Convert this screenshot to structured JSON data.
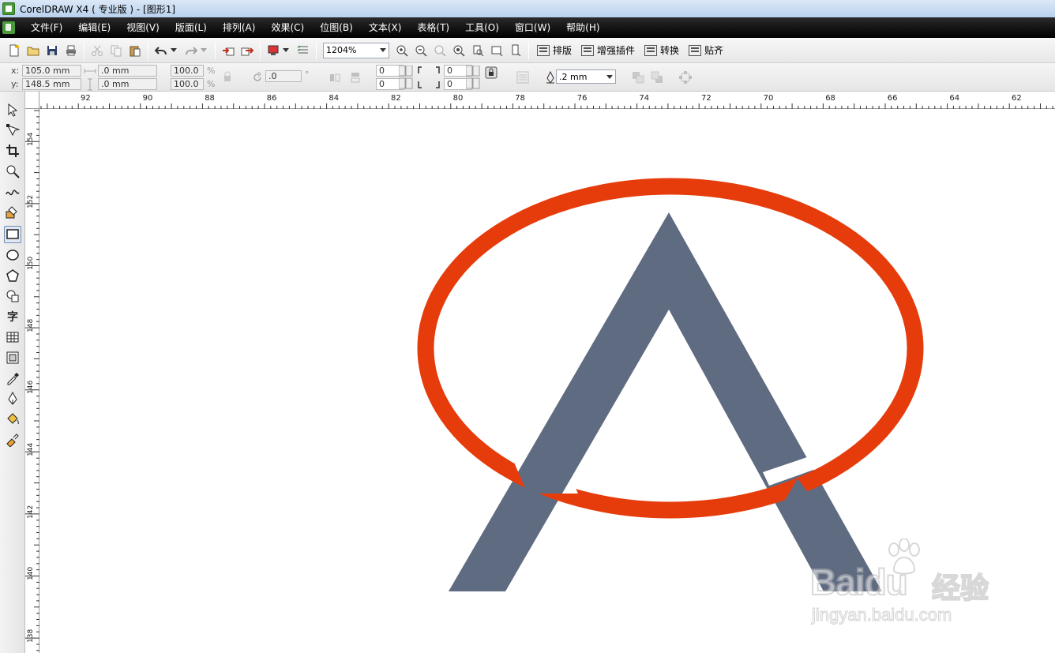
{
  "window": {
    "title": "CorelDRAW X4 ( 专业版 ) - [图形1]"
  },
  "menu": {
    "items": [
      "文件(F)",
      "编辑(E)",
      "视图(V)",
      "版面(L)",
      "排列(A)",
      "效果(C)",
      "位图(B)",
      "文本(X)",
      "表格(T)",
      "工具(O)",
      "窗口(W)",
      "帮助(H)"
    ]
  },
  "toolbar": {
    "zoom_value": "1204%",
    "plugins": [
      "排版",
      "增强插件",
      "转换",
      "贴齐"
    ]
  },
  "properties": {
    "x_label": "x:",
    "x_value": "105.0 mm",
    "y_label": "y:",
    "y_value": "148.5 mm",
    "width_value": ".0 mm",
    "height_value": ".0 mm",
    "scale_w": "100.0",
    "scale_h": "100.0",
    "percent": "%",
    "rotation": ".0",
    "degree": "°",
    "corner_a": "0",
    "corner_b": "0",
    "corner_c": "0",
    "corner_d": "0",
    "outline_width": ".2 mm"
  },
  "ruler": {
    "horizontal_labels": [
      "92",
      "90",
      "88",
      "86",
      "84",
      "82",
      "80",
      "78",
      "76",
      "74",
      "72",
      "70",
      "68",
      "66",
      "64",
      "62"
    ],
    "vertical_labels": [
      "154",
      "152",
      "150",
      "148",
      "146",
      "144",
      "142",
      "140",
      "138"
    ]
  },
  "artwork": {
    "ellipse_color": "#e63c0c",
    "letter_color": "#5f6b80"
  },
  "watermark": {
    "brand": "Baidu",
    "brand_cn": "经验",
    "url": "jingyan.baidu.com"
  },
  "colors": {
    "menubar": "#111111",
    "titlebar": "#c7dbf2"
  }
}
